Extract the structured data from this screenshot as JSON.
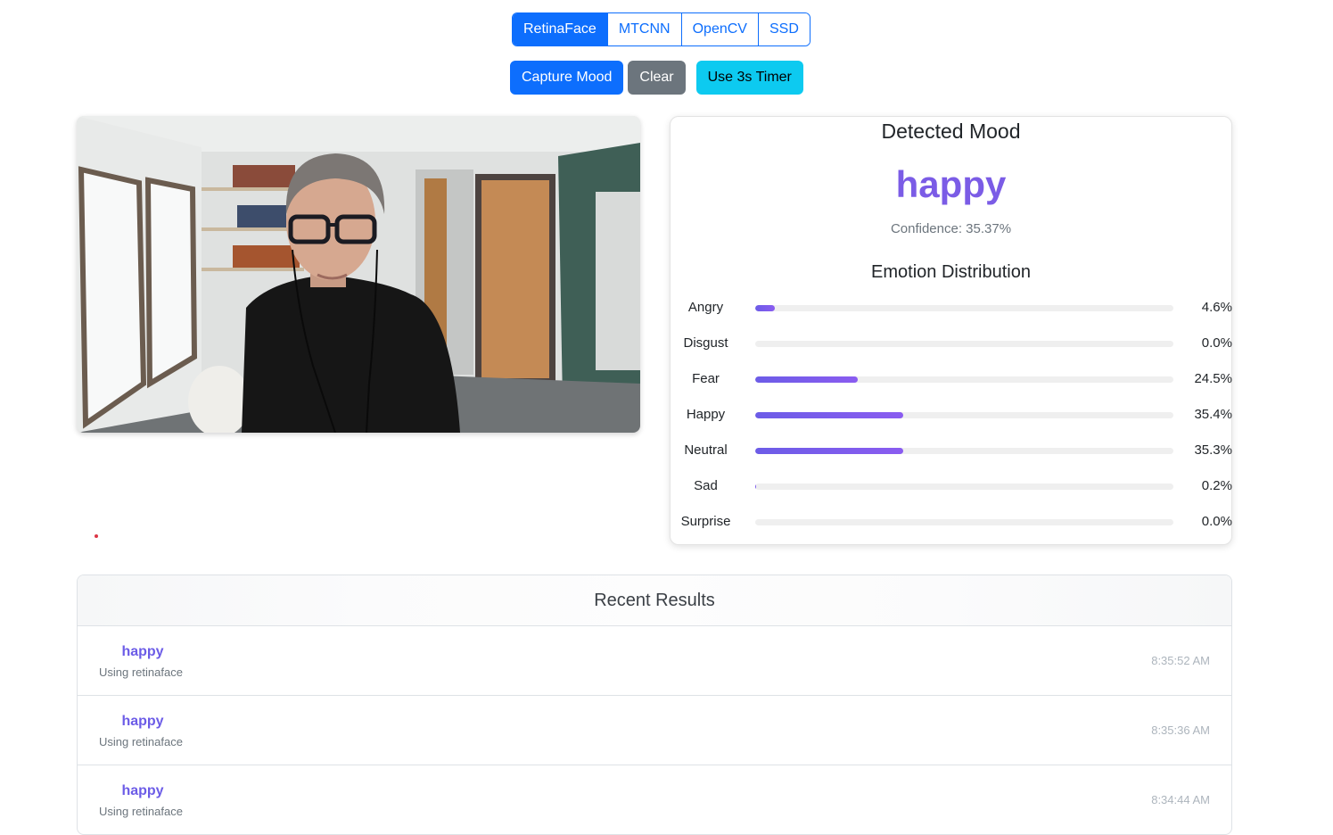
{
  "detectors": [
    {
      "label": "RetinaFace",
      "active": true
    },
    {
      "label": "MTCNN",
      "active": false
    },
    {
      "label": "OpenCV",
      "active": false
    },
    {
      "label": "SSD",
      "active": false
    }
  ],
  "actions": {
    "capture_label": "Capture Mood",
    "clear_label": "Clear",
    "timer_label": "Use 3s Timer"
  },
  "result": {
    "title": "Detected Mood",
    "mood": "happy",
    "confidence": "Confidence: 35.37%",
    "distribution_title": "Emotion Distribution",
    "accent_color": "#7b5ce6",
    "emotions": [
      {
        "label": "Angry",
        "value": "4.6%",
        "percent": 4.6
      },
      {
        "label": "Disgust",
        "value": "0.0%",
        "percent": 0.0
      },
      {
        "label": "Fear",
        "value": "24.5%",
        "percent": 24.5
      },
      {
        "label": "Happy",
        "value": "35.4%",
        "percent": 35.4
      },
      {
        "label": "Neutral",
        "value": "35.3%",
        "percent": 35.3
      },
      {
        "label": "Sad",
        "value": "0.2%",
        "percent": 0.2
      },
      {
        "label": "Surprise",
        "value": "0.0%",
        "percent": 0.0
      }
    ]
  },
  "recent": {
    "title": "Recent Results",
    "items": [
      {
        "mood": "happy",
        "sub": "Using retinaface",
        "time": "8:35:52 AM"
      },
      {
        "mood": "happy",
        "sub": "Using retinaface",
        "time": "8:35:36 AM"
      },
      {
        "mood": "happy",
        "sub": "Using retinaface",
        "time": "8:34:44 AM"
      }
    ]
  }
}
